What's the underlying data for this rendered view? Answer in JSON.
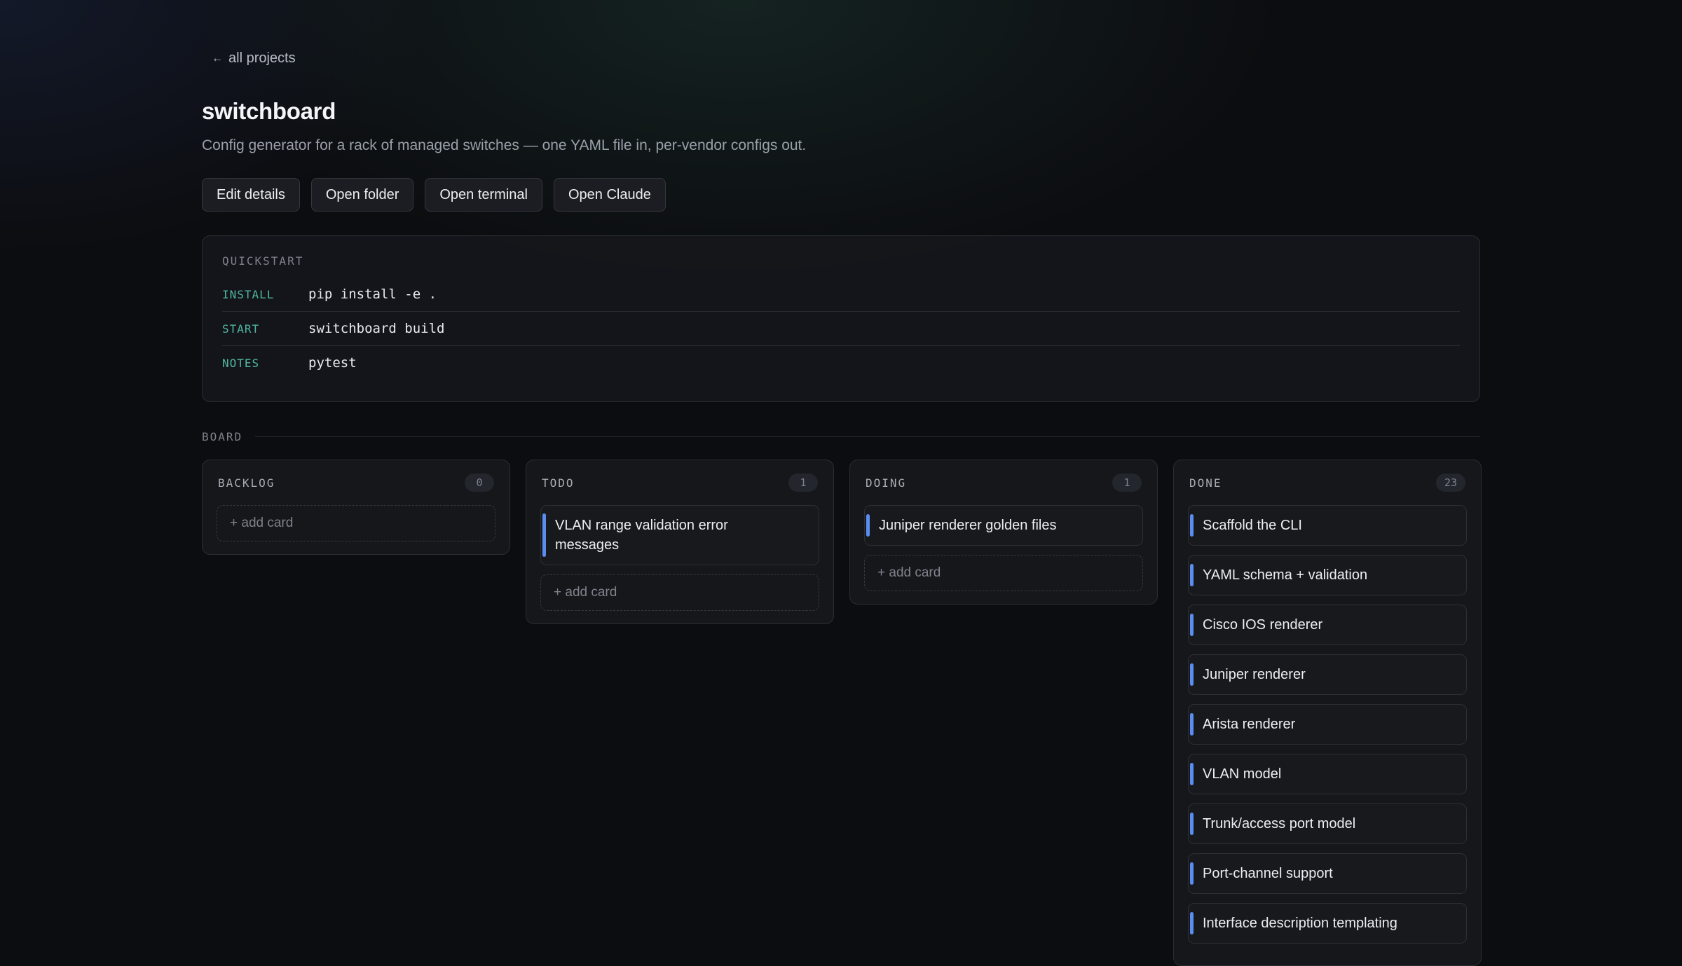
{
  "nav": {
    "back_arrow": "←",
    "back_label": "all projects"
  },
  "project": {
    "title": "switchboard",
    "description": "Config generator for a rack of managed switches — one YAML file in, per-vendor configs out."
  },
  "actions": {
    "edit": "Edit details",
    "folder": "Open folder",
    "terminal": "Open terminal",
    "claude": "Open Claude"
  },
  "quickstart": {
    "heading": "QUICKSTART",
    "rows": [
      {
        "key": "INSTALL",
        "value": "pip install -e ."
      },
      {
        "key": "START",
        "value": "switchboard build"
      },
      {
        "key": "NOTES",
        "value": "pytest"
      }
    ]
  },
  "board": {
    "label": "BOARD",
    "add_card_label": "+ add card",
    "accent_color": "#5b8cf0",
    "columns": [
      {
        "title": "BACKLOG",
        "count": "0",
        "cards": []
      },
      {
        "title": "TODO",
        "count": "1",
        "cards": [
          "VLAN range validation error messages"
        ]
      },
      {
        "title": "DOING",
        "count": "1",
        "cards": [
          "Juniper renderer golden files"
        ]
      },
      {
        "title": "DONE",
        "count": "23",
        "cards": [
          "Scaffold the CLI",
          "YAML schema + validation",
          "Cisco IOS renderer",
          "Juniper renderer",
          "Arista renderer",
          "VLAN model",
          "Trunk/access port model",
          "Port-channel support",
          "Interface description templating"
        ]
      }
    ]
  }
}
